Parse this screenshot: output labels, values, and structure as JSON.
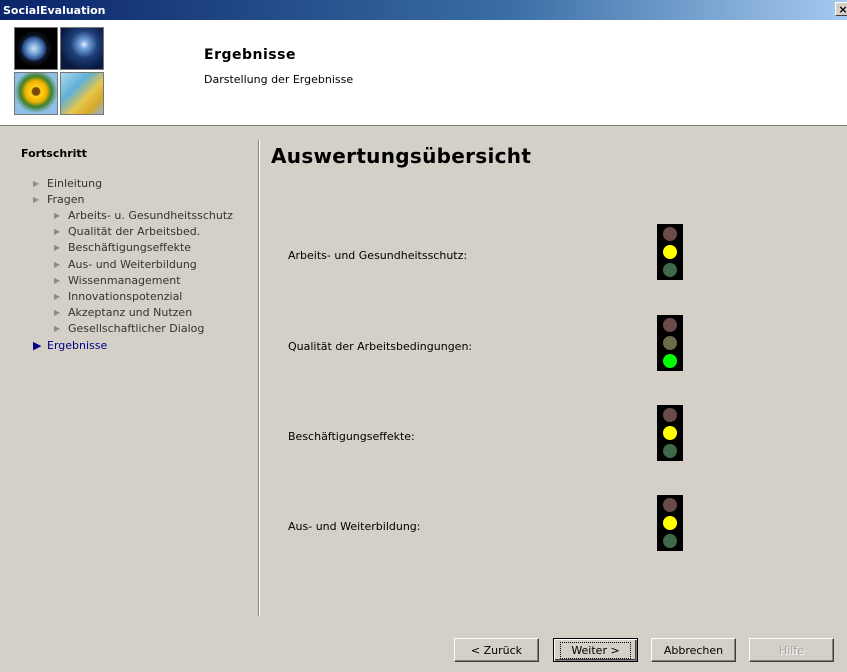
{
  "window": {
    "title": "SocialEvaluation",
    "close_label": "×"
  },
  "header": {
    "title": "Ergebnisse",
    "subtitle": "Darstellung der Ergebnisse"
  },
  "sidebar": {
    "heading": "Fortschritt",
    "items": [
      {
        "label": "Einleitung",
        "level": 0,
        "active": false
      },
      {
        "label": "Fragen",
        "level": 0,
        "active": false
      },
      {
        "label": "Arbeits- u. Gesundheitsschutz",
        "level": 1,
        "active": false
      },
      {
        "label": "Qualität der Arbeitsbed.",
        "level": 1,
        "active": false
      },
      {
        "label": "Beschäftigungseffekte",
        "level": 1,
        "active": false
      },
      {
        "label": "Aus- und Weiterbildung",
        "level": 1,
        "active": false
      },
      {
        "label": "Wissenmanagement",
        "level": 1,
        "active": false
      },
      {
        "label": "Innovationspotenzial",
        "level": 1,
        "active": false
      },
      {
        "label": "Akzeptanz und Nutzen",
        "level": 1,
        "active": false
      },
      {
        "label": "Gesellschaftlicher Dialog",
        "level": 1,
        "active": false
      },
      {
        "label": "Ergebnisse",
        "level": 0,
        "active": true
      }
    ]
  },
  "content": {
    "title": "Auswertungsübersicht",
    "results": [
      {
        "label": "Arbeits- und Gesundheitsschutz:",
        "status": "yellow"
      },
      {
        "label": "Qualität der Arbeitsbedingungen:",
        "status": "green"
      },
      {
        "label": "Beschäftigungseffekte:",
        "status": "yellow"
      },
      {
        "label": "Aus- und Weiterbildung:",
        "status": "yellow"
      }
    ]
  },
  "colors": {
    "red_on": "#ff0000",
    "red_off": "#6b4a4a",
    "yellow_on": "#ffff00",
    "yellow_off": "#6b6b4a",
    "green_on": "#00ff00",
    "green_off": "#3f6a4a"
  },
  "buttons": {
    "back": "< Zurück",
    "next": "Weiter >",
    "cancel": "Abbrechen",
    "help": "Hilfe"
  }
}
